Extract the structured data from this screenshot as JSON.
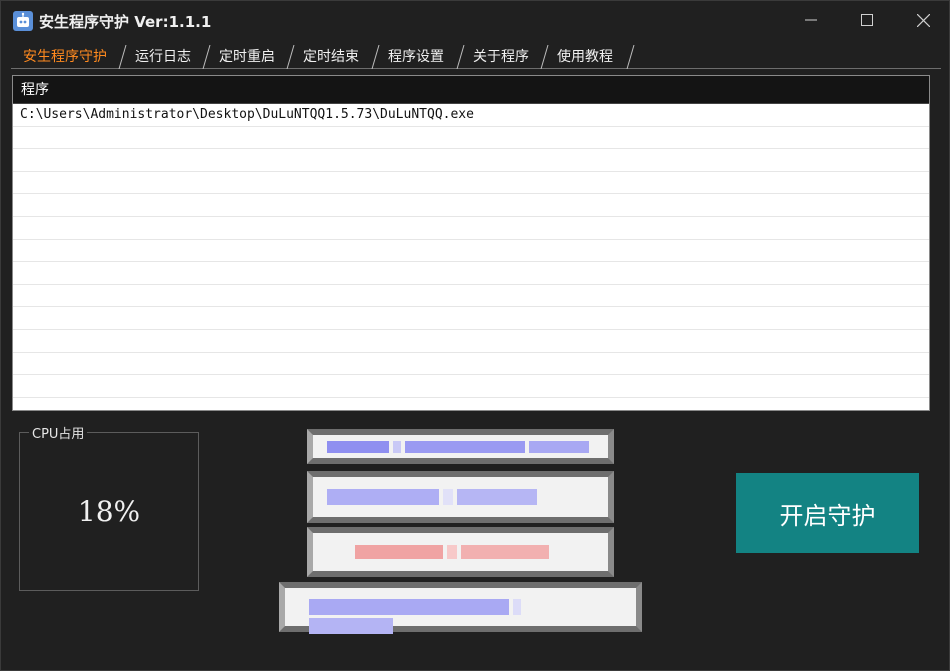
{
  "window": {
    "title": "安生程序守护 Ver:1.1.1",
    "icon": "robot-icon",
    "controls": [
      "minimize-icon",
      "maximize-icon",
      "close-icon"
    ]
  },
  "tabs": [
    {
      "label": "安生程序守护",
      "active": true
    },
    {
      "label": "运行日志",
      "active": false
    },
    {
      "label": "定时重启",
      "active": false
    },
    {
      "label": "定时结束",
      "active": false
    },
    {
      "label": "程序设置",
      "active": false
    },
    {
      "label": "关于程序",
      "active": false
    },
    {
      "label": "使用教程",
      "active": false
    }
  ],
  "program_list": {
    "column_header": "程序",
    "rows": [
      "C:\\Users\\Administrator\\Desktop\\DuLuNTQQ1.5.73\\DuLuNTQQ.exe"
    ]
  },
  "cpu": {
    "label": "CPU占用",
    "value": "18%"
  },
  "start_button": {
    "label": "开启守护"
  },
  "colors": {
    "background": "#202020",
    "active_tab": "#ff8a1f",
    "start_button": "#138383",
    "list_header": "#141414"
  }
}
